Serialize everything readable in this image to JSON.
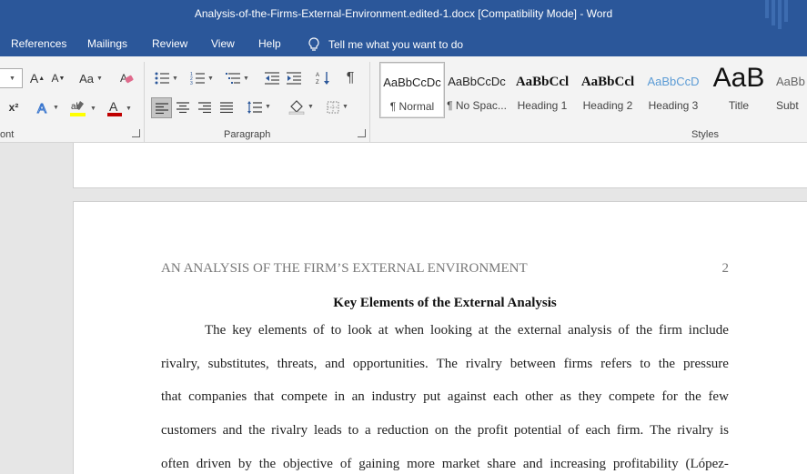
{
  "window": {
    "title": "Analysis-of-the-Firms-External-Environment.edited-1.docx [Compatibility Mode]  -  Word"
  },
  "tabs": [
    "References",
    "Mailings",
    "Review",
    "View",
    "Help"
  ],
  "tell_me": "Tell me what you want to do",
  "ribbon": {
    "font_group_label": "ont",
    "paragraph_group_label": "Paragraph",
    "styles_group_label": "Styles",
    "font_buttons": {
      "grow": "A",
      "shrink": "A",
      "change_case": "Aa",
      "superscript": "x²"
    },
    "styles": [
      {
        "sample": "AaBbCcDc",
        "name": "¶ Normal"
      },
      {
        "sample": "AaBbCcDc",
        "name": "¶ No Spac..."
      },
      {
        "sample": "AaBbCcl",
        "name": "Heading 1"
      },
      {
        "sample": "AaBbCcl",
        "name": "Heading 2"
      },
      {
        "sample": "AaBbCcD",
        "name": "Heading 3"
      },
      {
        "sample": "AaB",
        "name": "Title"
      },
      {
        "sample": "AaBb",
        "name": "Subt"
      }
    ],
    "colors": {
      "accent": "#2b579a",
      "highlight": "#ffff00",
      "font_color": "#c00000",
      "heading3": "#5b9bd5"
    }
  },
  "document": {
    "running_head": "AN ANALYSIS OF THE FIRM’S EXTERNAL ENVIRONMENT",
    "page_number": "2",
    "heading": "Key Elements of the External Analysis",
    "lines": [
      "The key elements of to look at when looking at the external analysis of the firm include",
      "rivalry, substitutes, threats, and opportunities.  The rivalry between firms refers to the pressure",
      "that companies that compete in an industry put against each other as they compete for the few",
      "customers and the rivalry leads to a reduction on the profit potential of each firm.  The rivalry is",
      "often driven by the objective of gaining more market share and increasing profitability (López-"
    ]
  }
}
